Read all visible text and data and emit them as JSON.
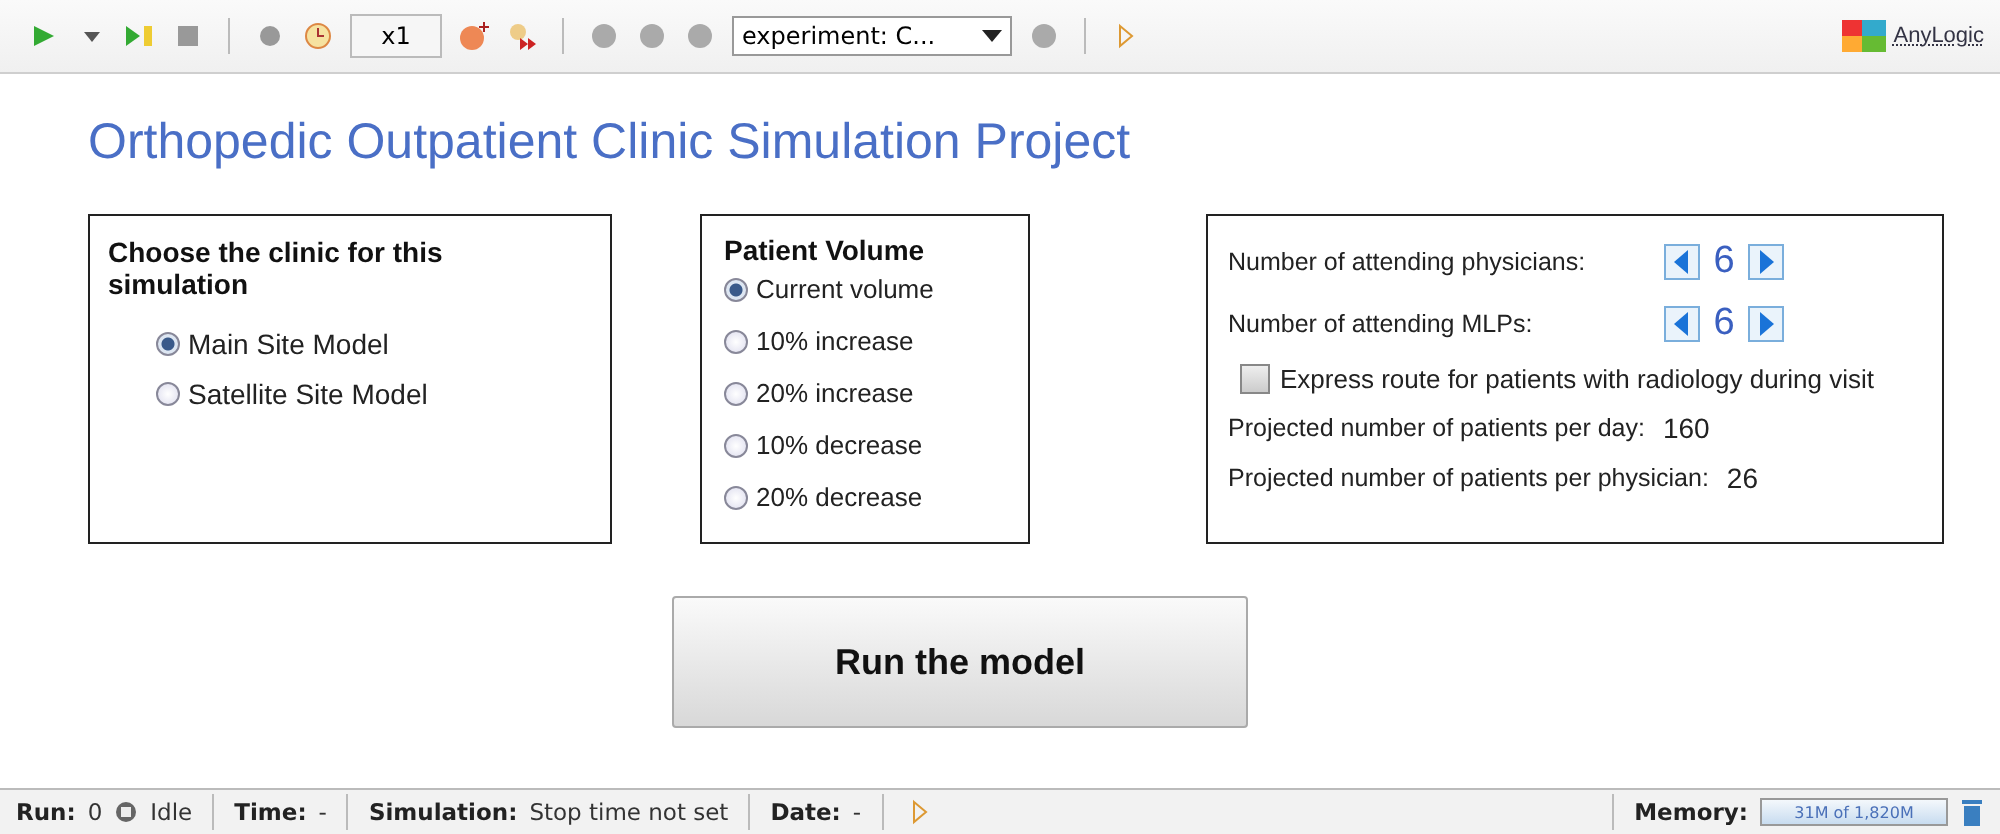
{
  "toolbar": {
    "speed": "x1",
    "experiment": "experiment: C...",
    "brand": "AnyLogic"
  },
  "title": "Orthopedic Outpatient Clinic Simulation Project",
  "clinic_panel": {
    "heading": "Choose the clinic for this simulation",
    "options": [
      {
        "label": "Main Site Model",
        "selected": true
      },
      {
        "label": "Satellite Site Model",
        "selected": false
      }
    ]
  },
  "volume_panel": {
    "heading": "Patient Volume",
    "options": [
      {
        "label": "Current volume",
        "selected": true
      },
      {
        "label": "10% increase",
        "selected": false
      },
      {
        "label": "20% increase",
        "selected": false
      },
      {
        "label": "10% decrease",
        "selected": false
      },
      {
        "label": "20% decrease",
        "selected": false
      }
    ]
  },
  "settings_panel": {
    "spinners": [
      {
        "label": "Number of attending physicians:",
        "value": "6"
      },
      {
        "label": "Number of attending MLPs:",
        "value": "6"
      }
    ],
    "express_route": {
      "label": "Express route for patients with radiology during visit",
      "checked": false
    },
    "outputs": [
      {
        "label": "Projected number of patients per day:",
        "value": "160"
      },
      {
        "label": "Projected number of patients per physician:",
        "value": "26"
      }
    ]
  },
  "run_button": "Run the model",
  "status_bar": {
    "run_label": "Run:",
    "run_value": "0",
    "state": "Idle",
    "time_label": "Time:",
    "time_value": "-",
    "simulation_label": "Simulation:",
    "simulation_value": "Stop time not set",
    "date_label": "Date:",
    "date_value": "-",
    "memory_label": "Memory:",
    "memory_value": "31M of 1,820M"
  }
}
